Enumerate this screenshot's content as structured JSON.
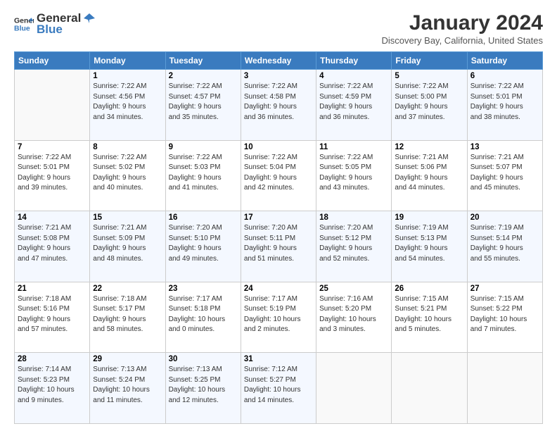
{
  "logo": {
    "line1": "General",
    "line2": "Blue"
  },
  "title": "January 2024",
  "subtitle": "Discovery Bay, California, United States",
  "weekdays": [
    "Sunday",
    "Monday",
    "Tuesday",
    "Wednesday",
    "Thursday",
    "Friday",
    "Saturday"
  ],
  "weeks": [
    [
      {
        "day": "",
        "info": ""
      },
      {
        "day": "1",
        "info": "Sunrise: 7:22 AM\nSunset: 4:56 PM\nDaylight: 9 hours\nand 34 minutes."
      },
      {
        "day": "2",
        "info": "Sunrise: 7:22 AM\nSunset: 4:57 PM\nDaylight: 9 hours\nand 35 minutes."
      },
      {
        "day": "3",
        "info": "Sunrise: 7:22 AM\nSunset: 4:58 PM\nDaylight: 9 hours\nand 36 minutes."
      },
      {
        "day": "4",
        "info": "Sunrise: 7:22 AM\nSunset: 4:59 PM\nDaylight: 9 hours\nand 36 minutes."
      },
      {
        "day": "5",
        "info": "Sunrise: 7:22 AM\nSunset: 5:00 PM\nDaylight: 9 hours\nand 37 minutes."
      },
      {
        "day": "6",
        "info": "Sunrise: 7:22 AM\nSunset: 5:01 PM\nDaylight: 9 hours\nand 38 minutes."
      }
    ],
    [
      {
        "day": "7",
        "info": "Sunrise: 7:22 AM\nSunset: 5:01 PM\nDaylight: 9 hours\nand 39 minutes."
      },
      {
        "day": "8",
        "info": "Sunrise: 7:22 AM\nSunset: 5:02 PM\nDaylight: 9 hours\nand 40 minutes."
      },
      {
        "day": "9",
        "info": "Sunrise: 7:22 AM\nSunset: 5:03 PM\nDaylight: 9 hours\nand 41 minutes."
      },
      {
        "day": "10",
        "info": "Sunrise: 7:22 AM\nSunset: 5:04 PM\nDaylight: 9 hours\nand 42 minutes."
      },
      {
        "day": "11",
        "info": "Sunrise: 7:22 AM\nSunset: 5:05 PM\nDaylight: 9 hours\nand 43 minutes."
      },
      {
        "day": "12",
        "info": "Sunrise: 7:21 AM\nSunset: 5:06 PM\nDaylight: 9 hours\nand 44 minutes."
      },
      {
        "day": "13",
        "info": "Sunrise: 7:21 AM\nSunset: 5:07 PM\nDaylight: 9 hours\nand 45 minutes."
      }
    ],
    [
      {
        "day": "14",
        "info": "Sunrise: 7:21 AM\nSunset: 5:08 PM\nDaylight: 9 hours\nand 47 minutes."
      },
      {
        "day": "15",
        "info": "Sunrise: 7:21 AM\nSunset: 5:09 PM\nDaylight: 9 hours\nand 48 minutes."
      },
      {
        "day": "16",
        "info": "Sunrise: 7:20 AM\nSunset: 5:10 PM\nDaylight: 9 hours\nand 49 minutes."
      },
      {
        "day": "17",
        "info": "Sunrise: 7:20 AM\nSunset: 5:11 PM\nDaylight: 9 hours\nand 51 minutes."
      },
      {
        "day": "18",
        "info": "Sunrise: 7:20 AM\nSunset: 5:12 PM\nDaylight: 9 hours\nand 52 minutes."
      },
      {
        "day": "19",
        "info": "Sunrise: 7:19 AM\nSunset: 5:13 PM\nDaylight: 9 hours\nand 54 minutes."
      },
      {
        "day": "20",
        "info": "Sunrise: 7:19 AM\nSunset: 5:14 PM\nDaylight: 9 hours\nand 55 minutes."
      }
    ],
    [
      {
        "day": "21",
        "info": "Sunrise: 7:18 AM\nSunset: 5:16 PM\nDaylight: 9 hours\nand 57 minutes."
      },
      {
        "day": "22",
        "info": "Sunrise: 7:18 AM\nSunset: 5:17 PM\nDaylight: 9 hours\nand 58 minutes."
      },
      {
        "day": "23",
        "info": "Sunrise: 7:17 AM\nSunset: 5:18 PM\nDaylight: 10 hours\nand 0 minutes."
      },
      {
        "day": "24",
        "info": "Sunrise: 7:17 AM\nSunset: 5:19 PM\nDaylight: 10 hours\nand 2 minutes."
      },
      {
        "day": "25",
        "info": "Sunrise: 7:16 AM\nSunset: 5:20 PM\nDaylight: 10 hours\nand 3 minutes."
      },
      {
        "day": "26",
        "info": "Sunrise: 7:15 AM\nSunset: 5:21 PM\nDaylight: 10 hours\nand 5 minutes."
      },
      {
        "day": "27",
        "info": "Sunrise: 7:15 AM\nSunset: 5:22 PM\nDaylight: 10 hours\nand 7 minutes."
      }
    ],
    [
      {
        "day": "28",
        "info": "Sunrise: 7:14 AM\nSunset: 5:23 PM\nDaylight: 10 hours\nand 9 minutes."
      },
      {
        "day": "29",
        "info": "Sunrise: 7:13 AM\nSunset: 5:24 PM\nDaylight: 10 hours\nand 11 minutes."
      },
      {
        "day": "30",
        "info": "Sunrise: 7:13 AM\nSunset: 5:25 PM\nDaylight: 10 hours\nand 12 minutes."
      },
      {
        "day": "31",
        "info": "Sunrise: 7:12 AM\nSunset: 5:27 PM\nDaylight: 10 hours\nand 14 minutes."
      },
      {
        "day": "",
        "info": ""
      },
      {
        "day": "",
        "info": ""
      },
      {
        "day": "",
        "info": ""
      }
    ]
  ]
}
